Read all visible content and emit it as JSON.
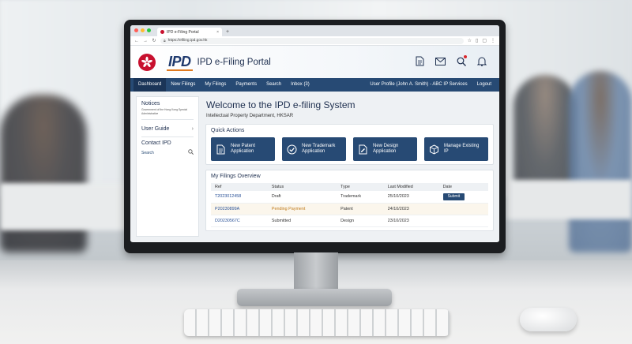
{
  "browser": {
    "tab_title": "IPD e-Filing Portal",
    "tab_close": "×",
    "new_tab": "+",
    "url": "https://efiling.ipd.gov.hk"
  },
  "header": {
    "logo_text": "IPD",
    "portal_title": "IPD e-Filing Portal",
    "icons": [
      "document-icon",
      "mail-icon",
      "search-icon",
      "bell-icon"
    ]
  },
  "nav": {
    "items": [
      {
        "label": "Dashboard"
      },
      {
        "label": "New Filings"
      },
      {
        "label": "My Filings"
      },
      {
        "label": "Payments"
      },
      {
        "label": "Search"
      },
      {
        "label": "Inbox (3)"
      }
    ],
    "user_profile": "User Profile (John A. Smith) - ABC IP Services",
    "logout": "Logout"
  },
  "sidebar": {
    "notices_title": "Notices",
    "notices_text": "Government of the Hong Kong Special Administrative",
    "user_guide": "User Guide",
    "contact": "Contact IPD",
    "search": "Search"
  },
  "main": {
    "welcome": "Welcome to the IPD e-filing System",
    "dept": "Intellectual Property Department, HKSAR",
    "quick_actions_title": "Quick Actions",
    "quick_actions": [
      {
        "label": "New Patent Application",
        "icon": "document-icon"
      },
      {
        "label": "New Trademark Application",
        "icon": "checkmark-icon"
      },
      {
        "label": "New Design Application",
        "icon": "design-doc-icon"
      },
      {
        "label": "Manage Existing IP",
        "icon": "box-icon"
      }
    ],
    "filings_title": "My Filings Overview",
    "filings_columns": [
      "Ref",
      "Status",
      "Type",
      "Last Modified",
      "Date"
    ],
    "filings_rows": [
      {
        "ref": "T2023012458",
        "status": "Draft",
        "type": "Trademark",
        "modified": "25/10/2023",
        "action": "Submit"
      },
      {
        "ref": "P20230899A",
        "status": "Pending Payment",
        "type": "Patent",
        "modified": "24/10/2023",
        "action": ""
      },
      {
        "ref": "D20230567C",
        "status": "Submitted",
        "type": "Design",
        "modified": "23/10/2023",
        "action": ""
      }
    ]
  },
  "colors": {
    "nav_bg": "#274a74",
    "accent_red": "#c8102e",
    "pending": "#c07a1a"
  }
}
